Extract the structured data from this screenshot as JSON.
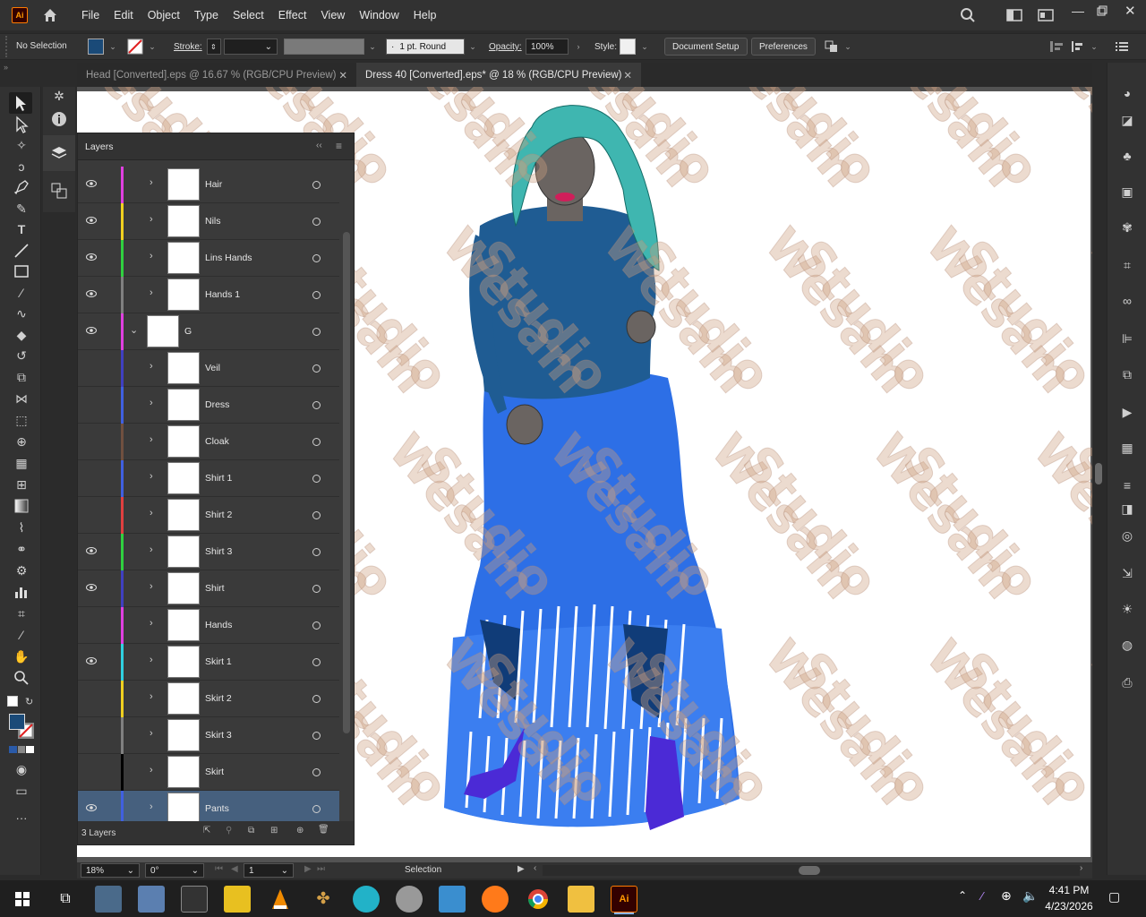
{
  "app": {
    "logo": "Ai"
  },
  "menu": [
    "File",
    "Edit",
    "Object",
    "Type",
    "Select",
    "Effect",
    "View",
    "Window",
    "Help"
  ],
  "control": {
    "selection": "No Selection",
    "stroke_label": "Stroke:",
    "brush": "1 pt. Round",
    "opacity_label": "Opacity:",
    "opacity_value": "100%",
    "style_label": "Style:",
    "document_setup": "Document Setup",
    "preferences": "Preferences"
  },
  "tabs": [
    {
      "label": "Head [Converted].eps @ 16.67 % (RGB/CPU Preview)",
      "active": false
    },
    {
      "label": "Dress 40 [Converted].eps* @ 18 % (RGB/CPU Preview)",
      "active": true
    }
  ],
  "layers_panel": {
    "title": "Layers",
    "footer_count": "3 Layers",
    "rows": [
      {
        "name": "Hair",
        "visible": true,
        "color": "#e040e0",
        "indent": 1
      },
      {
        "name": "Nils",
        "visible": true,
        "color": "#f0d020",
        "indent": 1
      },
      {
        "name": "Lins Hands",
        "visible": true,
        "color": "#30d040",
        "indent": 1
      },
      {
        "name": "Hands 1",
        "visible": true,
        "color": "#808080",
        "indent": 1
      },
      {
        "name": "G",
        "visible": true,
        "color": "#e040e0",
        "indent": 0,
        "expanded": true
      },
      {
        "name": "Veil",
        "visible": false,
        "color": "#4040c0",
        "indent": 1
      },
      {
        "name": "Dress",
        "visible": false,
        "color": "#4060e0",
        "indent": 1
      },
      {
        "name": "Cloak",
        "visible": false,
        "color": "#705040",
        "indent": 1
      },
      {
        "name": "Shirt 1",
        "visible": false,
        "color": "#4060e0",
        "indent": 1
      },
      {
        "name": "Shirt 2",
        "visible": false,
        "color": "#e04040",
        "indent": 1
      },
      {
        "name": "Shirt 3",
        "visible": true,
        "color": "#30d040",
        "indent": 1
      },
      {
        "name": "Shirt",
        "visible": true,
        "color": "#4040c0",
        "indent": 1
      },
      {
        "name": "Hands",
        "visible": false,
        "color": "#e040e0",
        "indent": 1
      },
      {
        "name": "Skirt 1",
        "visible": true,
        "color": "#30d0e0",
        "indent": 1
      },
      {
        "name": "Skirt 2",
        "visible": false,
        "color": "#f0d020",
        "indent": 1
      },
      {
        "name": "Skirt 3",
        "visible": false,
        "color": "#808080",
        "indent": 1
      },
      {
        "name": "Skirt",
        "visible": false,
        "color": "#000000",
        "indent": 1
      },
      {
        "name": "Pants",
        "visible": true,
        "color": "#4060e0",
        "indent": 1,
        "selected": true
      }
    ]
  },
  "canvas": {
    "watermark_line1": "Wesam",
    "watermark_line2": "Studio"
  },
  "status": {
    "zoom": "18%",
    "rotate": "0°",
    "artboard": "1",
    "tool": "Selection"
  },
  "taskbar": {
    "time": "4:41 PM",
    "date": "4/23/2026"
  },
  "colors": {
    "fill": "#1a4a78",
    "dress_blue": "#2d6fe6",
    "top_blue": "#1f5c93",
    "hair": "#3fb6b0",
    "shoes": "#4b2ad6"
  }
}
